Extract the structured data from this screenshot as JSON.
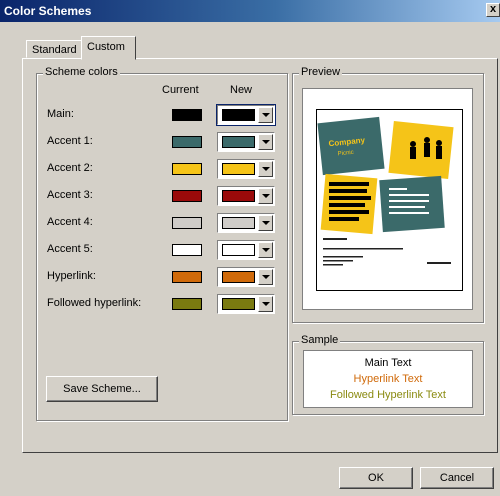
{
  "window": {
    "title": "Color Schemes",
    "close_glyph": "x"
  },
  "tabs": [
    {
      "label": "Standard",
      "active": false
    },
    {
      "label": "Custom",
      "active": true
    }
  ],
  "scheme_group": {
    "label": "Scheme colors",
    "col_current": "Current",
    "col_new": "New",
    "rows": [
      {
        "label": "Main:",
        "current": "#000000",
        "new": "#000000"
      },
      {
        "label": "Accent 1:",
        "current": "#3b6a6a",
        "new": "#3b6a6a"
      },
      {
        "label": "Accent 2:",
        "current": "#f5c418",
        "new": "#f5c418"
      },
      {
        "label": "Accent 3:",
        "current": "#9a0a0a",
        "new": "#9a0a0a"
      },
      {
        "label": "Accent 4:",
        "current": "#cfccc8",
        "new": "#cfccc8"
      },
      {
        "label": "Accent 5:",
        "current": "#ffffff",
        "new": "#ffffff"
      },
      {
        "label": "Hyperlink:",
        "current": "#d06a0a",
        "new": "#d06a0a"
      },
      {
        "label": "Followed hyperlink:",
        "current": "#7a7a10",
        "new": "#7a7a10"
      }
    ],
    "save_button": "Save Scheme..."
  },
  "preview": {
    "label": "Preview",
    "heading": "Company Picnic",
    "colors": {
      "teal": "#3b6a6a",
      "yellow": "#f5c418",
      "black": "#000000"
    }
  },
  "sample": {
    "label": "Sample",
    "main_text": "Main Text",
    "hyperlink_text": "Hyperlink Text",
    "followed_text": "Followed Hyperlink Text",
    "colors": {
      "main": "#000000",
      "hyperlink": "#d06a0a",
      "followed": "#8a8a10"
    }
  },
  "buttons": {
    "ok": "OK",
    "cancel": "Cancel"
  }
}
